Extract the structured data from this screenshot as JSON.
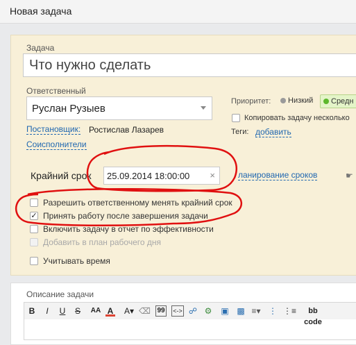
{
  "window": {
    "title": "Новая задача"
  },
  "task": {
    "label": "Задача",
    "placeholder": "Что нужно сделать"
  },
  "responsible": {
    "label": "Ответственный",
    "value": "Руслан Рузыев"
  },
  "creator": {
    "link": "Постановщик:",
    "name": "Ростислав Лазарев"
  },
  "coexecutors": {
    "link": "Соисполнители"
  },
  "priority": {
    "label": "Приоритет:",
    "low": "Низкий",
    "mid": "Средн"
  },
  "copy_task": {
    "label": "Копировать задачу несколько"
  },
  "tags": {
    "label": "Теги:",
    "add": "добавить"
  },
  "deadline": {
    "label": "Крайний срок",
    "value": "25.09.2014 18:00:00",
    "clear": "×",
    "planning": "ланирование сроков"
  },
  "options": [
    {
      "label": "Разрешить ответственному менять крайний срок",
      "checked": false,
      "disabled": false
    },
    {
      "label": "Принять работу после завершения задачи",
      "checked": true,
      "disabled": false
    },
    {
      "label": "Включить задачу в отчет по эффективности",
      "checked": false,
      "disabled": false
    },
    {
      "label": "Добавить в план рабочего дня",
      "checked": false,
      "disabled": true
    }
  ],
  "track_time": {
    "label": "Учитывать время"
  },
  "description": {
    "label": "Описание задачи"
  },
  "toolbar": {
    "bold": "B",
    "italic": "I",
    "underline": "U",
    "strike": "S",
    "quote": "99",
    "code": "<->",
    "bbcode": "bb code"
  },
  "colors": {
    "accent_link": "#2067b0",
    "form_bg": "#f8f0d8",
    "annotation": "#e01010",
    "priority_mid": "#5cb82c"
  }
}
